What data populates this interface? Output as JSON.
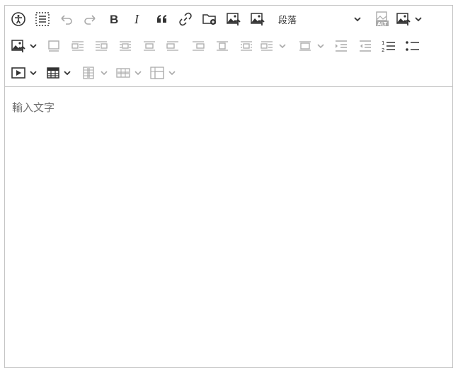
{
  "toolbar": {
    "heading_dropdown_label": "段落",
    "colors": {
      "active": "#333333",
      "disabled": "#aaaaaa",
      "border": "#c4c4c4"
    },
    "row1": [
      {
        "name": "accessibility-button",
        "icon": "accessibility-icon",
        "enabled": true
      },
      {
        "name": "select-all-button",
        "icon": "select-all-icon",
        "enabled": true
      },
      {
        "name": "undo-button",
        "icon": "undo-icon",
        "enabled": false
      },
      {
        "name": "redo-button",
        "icon": "redo-icon",
        "enabled": false
      },
      {
        "name": "bold-button",
        "icon": "bold-icon",
        "enabled": true
      },
      {
        "name": "italic-button",
        "icon": "italic-icon",
        "enabled": true
      },
      {
        "name": "blockquote-button",
        "icon": "quote-icon",
        "enabled": true
      },
      {
        "name": "link-button",
        "icon": "link-icon",
        "enabled": true
      },
      {
        "name": "file-manager-button",
        "icon": "folder-add-icon",
        "enabled": true
      },
      {
        "name": "upload-image-button",
        "icon": "image-upload-icon",
        "enabled": true
      },
      {
        "name": "insert-image-url-button",
        "icon": "image-upload-icon",
        "enabled": true
      },
      {
        "name": "heading-dropdown",
        "icon": "chevron-down-icon",
        "enabled": true
      },
      {
        "name": "alt-text-button",
        "icon": "image-alt-icon",
        "enabled": false
      },
      {
        "name": "image-insert-dropdown",
        "icon": "image-upload-icon",
        "enabled": true
      }
    ],
    "row2": [
      {
        "name": "image-insert-dropdown-2",
        "icon": "image-upload-icon",
        "enabled": true
      },
      {
        "name": "toggle-caption-button",
        "icon": "caption-icon",
        "enabled": false
      },
      {
        "name": "image-align-left-button",
        "icon": "align-left-icon",
        "enabled": false
      },
      {
        "name": "image-align-right-button",
        "icon": "align-right-icon",
        "enabled": false
      },
      {
        "name": "image-align-center-button",
        "icon": "align-center-icon",
        "enabled": false
      },
      {
        "name": "image-inline-button",
        "icon": "inline-icon",
        "enabled": false
      },
      {
        "name": "image-block-left-button",
        "icon": "block-left-icon",
        "enabled": false
      },
      {
        "name": "image-block-right-button",
        "icon": "block-right-icon",
        "enabled": false
      },
      {
        "name": "image-side-button",
        "icon": "side-icon",
        "enabled": false
      },
      {
        "name": "image-wrap-dropdown",
        "icon": "wrap-icon",
        "enabled": false
      },
      {
        "name": "image-break-dropdown",
        "icon": "break-icon",
        "enabled": false
      },
      {
        "name": "indent-button",
        "icon": "indent-icon",
        "enabled": false
      },
      {
        "name": "outdent-button",
        "icon": "outdent-icon",
        "enabled": false
      },
      {
        "name": "numbered-list-button",
        "icon": "numbered-list-icon",
        "enabled": true
      },
      {
        "name": "bulleted-list-button",
        "icon": "bulleted-list-icon",
        "enabled": true
      }
    ],
    "row3": [
      {
        "name": "media-embed-dropdown",
        "icon": "media-icon",
        "enabled": true
      },
      {
        "name": "insert-table-dropdown",
        "icon": "table-icon",
        "enabled": true
      },
      {
        "name": "table-column-dropdown",
        "icon": "table-column-icon",
        "enabled": false
      },
      {
        "name": "table-row-dropdown",
        "icon": "table-row-icon",
        "enabled": false
      },
      {
        "name": "merge-cells-dropdown",
        "icon": "merge-cells-icon",
        "enabled": false
      }
    ]
  },
  "editor": {
    "placeholder": "輸入文字"
  }
}
